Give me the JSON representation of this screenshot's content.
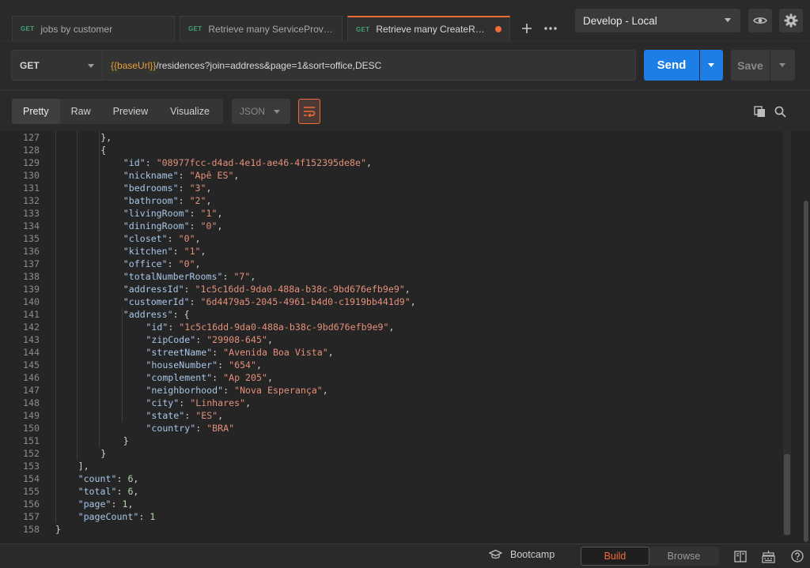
{
  "tabs": [
    {
      "method": "GET",
      "label": "jobs by customer",
      "active": false,
      "unsaved": false
    },
    {
      "method": "GET",
      "label": "Retrieve many ServiceProvid...",
      "active": false,
      "unsaved": false
    },
    {
      "method": "GET",
      "label": "Retrieve many CreateReside...",
      "active": true,
      "unsaved": true
    }
  ],
  "tab_actions": {
    "add_icon": "plus-icon",
    "more_icon": "more-horizontal-icon"
  },
  "environment": {
    "selected": "Develop - Local",
    "eye_icon": "eye-icon",
    "settings_icon": "gear-icon"
  },
  "request": {
    "method": "GET",
    "url_variable": "{{baseUrl}}",
    "url_path": "/residences?join=address&page=1&sort=office,DESC",
    "send_label": "Send",
    "save_label": "Save"
  },
  "response": {
    "view_tabs": [
      "Pretty",
      "Raw",
      "Preview",
      "Visualize"
    ],
    "active_view": "Pretty",
    "format": "JSON",
    "wrap_icon": "wrap-lines-icon",
    "copy_icon": "copy-icon",
    "search_icon": "search-icon"
  },
  "code_lines": [
    {
      "n": "127",
      "indent": 4,
      "parts": [
        [
          "p",
          "},"
        ]
      ]
    },
    {
      "n": "128",
      "indent": 4,
      "parts": [
        [
          "p",
          "{"
        ]
      ]
    },
    {
      "n": "129",
      "indent": 6,
      "parts": [
        [
          "k",
          "\"id\""
        ],
        [
          "p",
          ": "
        ],
        [
          "s",
          "\"08977fcc-d4ad-4e1d-ae46-4f152395de8e\""
        ],
        [
          "p",
          ","
        ]
      ]
    },
    {
      "n": "130",
      "indent": 6,
      "parts": [
        [
          "k",
          "\"nickname\""
        ],
        [
          "p",
          ": "
        ],
        [
          "s",
          "\"Apê ES\""
        ],
        [
          "p",
          ","
        ]
      ]
    },
    {
      "n": "131",
      "indent": 6,
      "parts": [
        [
          "k",
          "\"bedrooms\""
        ],
        [
          "p",
          ": "
        ],
        [
          "s",
          "\"3\""
        ],
        [
          "p",
          ","
        ]
      ]
    },
    {
      "n": "132",
      "indent": 6,
      "parts": [
        [
          "k",
          "\"bathroom\""
        ],
        [
          "p",
          ": "
        ],
        [
          "s",
          "\"2\""
        ],
        [
          "p",
          ","
        ]
      ]
    },
    {
      "n": "133",
      "indent": 6,
      "parts": [
        [
          "k",
          "\"livingRoom\""
        ],
        [
          "p",
          ": "
        ],
        [
          "s",
          "\"1\""
        ],
        [
          "p",
          ","
        ]
      ]
    },
    {
      "n": "134",
      "indent": 6,
      "parts": [
        [
          "k",
          "\"diningRoom\""
        ],
        [
          "p",
          ": "
        ],
        [
          "s",
          "\"0\""
        ],
        [
          "p",
          ","
        ]
      ]
    },
    {
      "n": "135",
      "indent": 6,
      "parts": [
        [
          "k",
          "\"closet\""
        ],
        [
          "p",
          ": "
        ],
        [
          "s",
          "\"0\""
        ],
        [
          "p",
          ","
        ]
      ]
    },
    {
      "n": "136",
      "indent": 6,
      "parts": [
        [
          "k",
          "\"kitchen\""
        ],
        [
          "p",
          ": "
        ],
        [
          "s",
          "\"1\""
        ],
        [
          "p",
          ","
        ]
      ]
    },
    {
      "n": "137",
      "indent": 6,
      "parts": [
        [
          "k",
          "\"office\""
        ],
        [
          "p",
          ": "
        ],
        [
          "s",
          "\"0\""
        ],
        [
          "p",
          ","
        ]
      ]
    },
    {
      "n": "138",
      "indent": 6,
      "parts": [
        [
          "k",
          "\"totalNumberRooms\""
        ],
        [
          "p",
          ": "
        ],
        [
          "s",
          "\"7\""
        ],
        [
          "p",
          ","
        ]
      ]
    },
    {
      "n": "139",
      "indent": 6,
      "parts": [
        [
          "k",
          "\"addressId\""
        ],
        [
          "p",
          ": "
        ],
        [
          "s",
          "\"1c5c16dd-9da0-488a-b38c-9bd676efb9e9\""
        ],
        [
          "p",
          ","
        ]
      ]
    },
    {
      "n": "140",
      "indent": 6,
      "parts": [
        [
          "k",
          "\"customerId\""
        ],
        [
          "p",
          ": "
        ],
        [
          "s",
          "\"6d4479a5-2045-4961-b4d0-c1919bb441d9\""
        ],
        [
          "p",
          ","
        ]
      ]
    },
    {
      "n": "141",
      "indent": 6,
      "parts": [
        [
          "k",
          "\"address\""
        ],
        [
          "p",
          ": {"
        ]
      ]
    },
    {
      "n": "142",
      "indent": 8,
      "parts": [
        [
          "k",
          "\"id\""
        ],
        [
          "p",
          ": "
        ],
        [
          "s",
          "\"1c5c16dd-9da0-488a-b38c-9bd676efb9e9\""
        ],
        [
          "p",
          ","
        ]
      ]
    },
    {
      "n": "143",
      "indent": 8,
      "parts": [
        [
          "k",
          "\"zipCode\""
        ],
        [
          "p",
          ": "
        ],
        [
          "s",
          "\"29908-645\""
        ],
        [
          "p",
          ","
        ]
      ]
    },
    {
      "n": "144",
      "indent": 8,
      "parts": [
        [
          "k",
          "\"streetName\""
        ],
        [
          "p",
          ": "
        ],
        [
          "s",
          "\"Avenida Boa Vista\""
        ],
        [
          "p",
          ","
        ]
      ]
    },
    {
      "n": "145",
      "indent": 8,
      "parts": [
        [
          "k",
          "\"houseNumber\""
        ],
        [
          "p",
          ": "
        ],
        [
          "s",
          "\"654\""
        ],
        [
          "p",
          ","
        ]
      ]
    },
    {
      "n": "146",
      "indent": 8,
      "parts": [
        [
          "k",
          "\"complement\""
        ],
        [
          "p",
          ": "
        ],
        [
          "s",
          "\"Ap 205\""
        ],
        [
          "p",
          ","
        ]
      ]
    },
    {
      "n": "147",
      "indent": 8,
      "parts": [
        [
          "k",
          "\"neighborhood\""
        ],
        [
          "p",
          ": "
        ],
        [
          "s",
          "\"Nova Esperança\""
        ],
        [
          "p",
          ","
        ]
      ]
    },
    {
      "n": "148",
      "indent": 8,
      "parts": [
        [
          "k",
          "\"city\""
        ],
        [
          "p",
          ": "
        ],
        [
          "s",
          "\"Linhares\""
        ],
        [
          "p",
          ","
        ]
      ]
    },
    {
      "n": "149",
      "indent": 8,
      "parts": [
        [
          "k",
          "\"state\""
        ],
        [
          "p",
          ": "
        ],
        [
          "s",
          "\"ES\""
        ],
        [
          "p",
          ","
        ]
      ]
    },
    {
      "n": "150",
      "indent": 8,
      "parts": [
        [
          "k",
          "\"country\""
        ],
        [
          "p",
          ": "
        ],
        [
          "s",
          "\"BRA\""
        ]
      ]
    },
    {
      "n": "151",
      "indent": 6,
      "parts": [
        [
          "p",
          "}"
        ]
      ]
    },
    {
      "n": "152",
      "indent": 4,
      "parts": [
        [
          "p",
          "}"
        ]
      ]
    },
    {
      "n": "153",
      "indent": 2,
      "parts": [
        [
          "p",
          "],"
        ]
      ]
    },
    {
      "n": "154",
      "indent": 2,
      "parts": [
        [
          "k",
          "\"count\""
        ],
        [
          "p",
          ": "
        ],
        [
          "n",
          "6"
        ],
        [
          "p",
          ","
        ]
      ]
    },
    {
      "n": "155",
      "indent": 2,
      "parts": [
        [
          "k",
          "\"total\""
        ],
        [
          "p",
          ": "
        ],
        [
          "n",
          "6"
        ],
        [
          "p",
          ","
        ]
      ]
    },
    {
      "n": "156",
      "indent": 2,
      "parts": [
        [
          "k",
          "\"page\""
        ],
        [
          "p",
          ": "
        ],
        [
          "n",
          "1"
        ],
        [
          "p",
          ","
        ]
      ]
    },
    {
      "n": "157",
      "indent": 2,
      "parts": [
        [
          "k",
          "\"pageCount\""
        ],
        [
          "p",
          ": "
        ],
        [
          "n",
          "1"
        ]
      ]
    },
    {
      "n": "158",
      "indent": 0,
      "parts": [
        [
          "p",
          "}"
        ]
      ]
    }
  ],
  "statusbar": {
    "bootcamp_label": "Bootcamp",
    "build_label": "Build",
    "browse_label": "Browse",
    "active_mode": "Build"
  },
  "colors": {
    "accent": "#f26b3a",
    "send": "#1d7ee6",
    "json_key": "#a8c6e8",
    "json_string": "#e4907a",
    "json_number": "#b5d6a8",
    "get_method": "#40a070"
  }
}
